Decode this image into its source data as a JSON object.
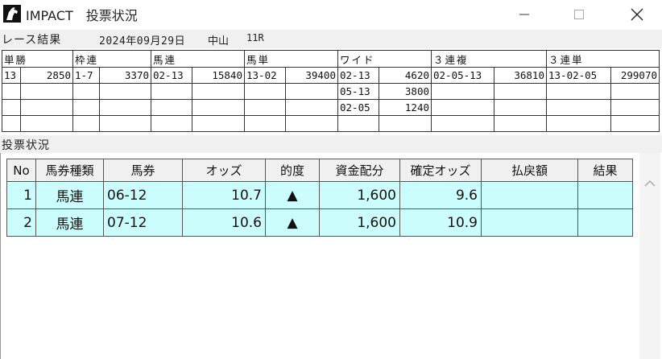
{
  "window": {
    "title": "IMPACT　投票状況",
    "logo_icon": "horse-head-icon",
    "controls": [
      "minimize-icon",
      "maximize-icon",
      "close-icon"
    ]
  },
  "race": {
    "label": "レース結果",
    "date": "2024年09月29日",
    "venue": "中山",
    "race_no": "11R",
    "bet_types": [
      "単勝",
      "枠連",
      "馬連",
      "馬単",
      "ワイド",
      "３連複",
      "３連単"
    ],
    "rows": [
      [
        "13",
        "2850",
        "1-7",
        "3370",
        "02-13",
        "15840",
        "13-02",
        "39400",
        "02-13",
        "4620",
        "02-05-13",
        "36810",
        "13-02-05",
        "299070"
      ],
      [
        "",
        "",
        "",
        "",
        "",
        "",
        "",
        "",
        "05-13",
        "3800",
        "",
        "",
        "",
        ""
      ],
      [
        "",
        "",
        "",
        "",
        "",
        "",
        "",
        "",
        "02-05",
        "1240",
        "",
        "",
        "",
        ""
      ],
      [
        "",
        "",
        "",
        "",
        "",
        "",
        "",
        "",
        "",
        "",
        "",
        "",
        "",
        ""
      ]
    ]
  },
  "vote_status": {
    "label": "投票状況",
    "headers": [
      "No",
      "馬券種類",
      "馬券",
      "オッズ",
      "的度",
      "資金配分",
      "確定オッズ",
      "払戻額",
      "結果"
    ],
    "rows": [
      [
        "1",
        "馬連",
        "06-12",
        "10.7",
        "▲",
        "1,600",
        "9.6",
        "",
        ""
      ],
      [
        "2",
        "馬連",
        "07-12",
        "10.6",
        "▲",
        "1,600",
        "10.9",
        "",
        ""
      ]
    ]
  },
  "colors": {
    "row_highlight": "#ccfdfd",
    "header_bg": "#f0f0f0",
    "border": "#333333"
  }
}
